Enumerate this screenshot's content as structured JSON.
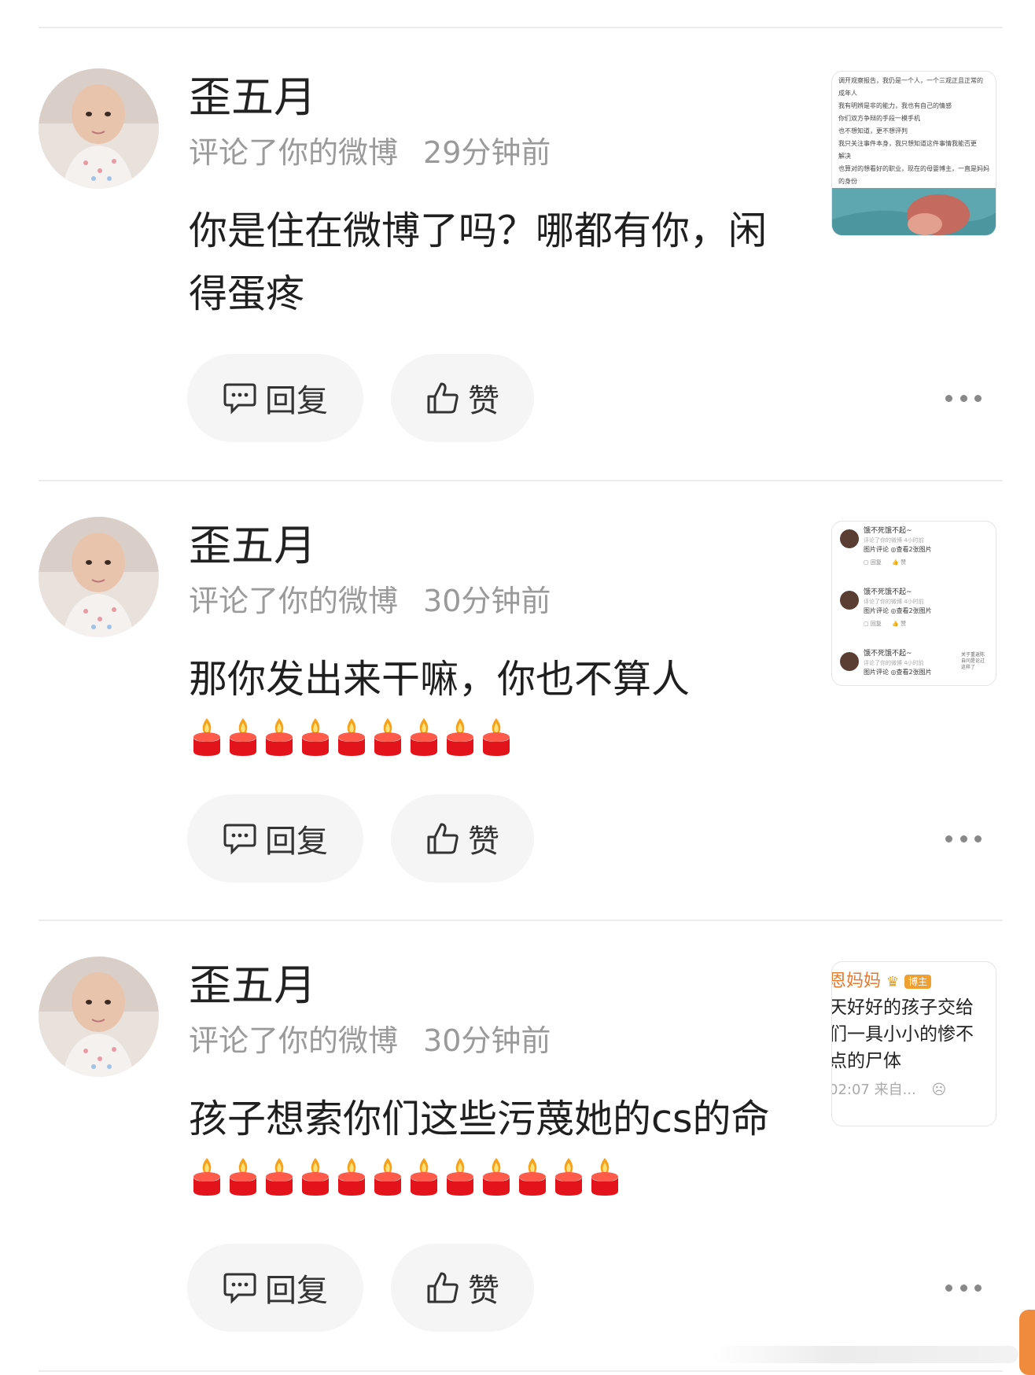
{
  "comments": [
    {
      "username": "歪五月",
      "action": "评论了你的微博",
      "time": "29分钟前",
      "text": "你是住在微博了吗？哪都有你，闲得蛋疼",
      "candles": 0,
      "reply_label": "回复",
      "like_label": "赞",
      "thumb": {
        "type": "text-photo",
        "lines": [
          "调开观察报告，我仍是一个人，一个三观正且正常的",
          "成年人",
          "我有明辨是非的能力，我也有自己的情感",
          "你们双方争辩的手段一模手机",
          "也不想知道，更不想评判",
          "我只关注事件本身，我只想知道这件事情我能否更",
          "解决",
          "也算对的想看好的职业，现在的母婴博主，一直是妈妈",
          "的身份"
        ]
      }
    },
    {
      "username": "歪五月",
      "action": "评论了你的微博",
      "time": "30分钟前",
      "text": "那你发出来干嘛，你也不算人",
      "candles": 9,
      "reply_label": "回复",
      "like_label": "赞",
      "thumb": {
        "type": "comment-list",
        "items": [
          {
            "name": "饿不死饿不起~",
            "sub": "评论了你的微博 4小时前",
            "body": "图片评论 ◎查看2张图片",
            "side": ""
          },
          {
            "name": "饿不死饿不起~",
            "sub": "评论了你的微博 4小时前",
            "body": "图片评论 ◎查看2张图片",
            "side": ""
          },
          {
            "name": "饿不死饿不起~",
            "sub": "评论了你的微博 4小时前",
            "body": "图片评论 ◎查看2张图片",
            "side": "关于重返陈 自问是论过 这样了"
          }
        ],
        "mini_reply": "回复",
        "mini_like": "赞"
      }
    },
    {
      "username": "歪五月",
      "action": "评论了你的微博",
      "time": "30分钟前",
      "text": "孩子想索你们这些污蔑她的cs的命",
      "candles": 12,
      "reply_label": "回复",
      "like_label": "赞",
      "thumb": {
        "type": "post-snippet",
        "author": "恩妈妈",
        "badge": "博主",
        "lines": [
          "天好好的孩子交给",
          "们一具小小的惨不",
          "点的尸体"
        ],
        "footer": "02:07 来自..."
      }
    }
  ],
  "colors": {
    "accent": "#f08a3c",
    "meta": "#9a9a9a",
    "button_bg": "#f5f5f5"
  }
}
